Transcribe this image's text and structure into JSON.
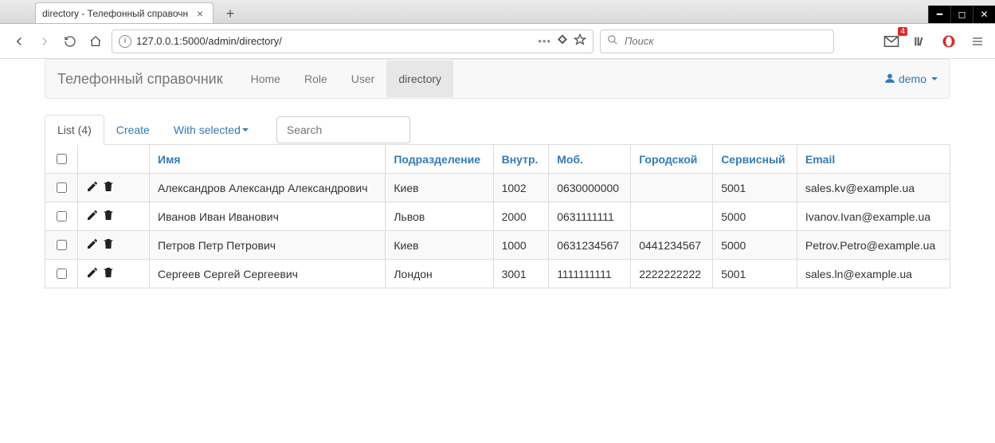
{
  "browser": {
    "tab_title": "directory - Телефонный справочн",
    "url": "127.0.0.1:5000/admin/directory/",
    "search_placeholder": "Поиск",
    "mail_badge": "4"
  },
  "navbar": {
    "brand": "Телефонный справочник",
    "links": [
      "Home",
      "Role",
      "User",
      "directory"
    ],
    "active_index": 3,
    "user": "demo"
  },
  "actions": {
    "list_label": "List (4)",
    "create_label": "Create",
    "with_selected_label": "With selected",
    "search_placeholder": "Search"
  },
  "table": {
    "columns": [
      "Имя",
      "Подразделение",
      "Внутр.",
      "Моб.",
      "Городской",
      "Сервисный",
      "Email"
    ],
    "rows": [
      {
        "name": "Александров Александр Александрович",
        "dept": "Киев",
        "ext": "1002",
        "mobile": "0630000000",
        "city": "",
        "service": "5001",
        "email": "sales.kv@example.ua"
      },
      {
        "name": "Иванов Иван Иванович",
        "dept": "Львов",
        "ext": "2000",
        "mobile": "0631111111",
        "city": "",
        "service": "5000",
        "email": "Ivanov.Ivan@example.ua"
      },
      {
        "name": "Петров Петр Петрович",
        "dept": "Киев",
        "ext": "1000",
        "mobile": "0631234567",
        "city": "0441234567",
        "service": "5000",
        "email": "Petrov.Petro@example.ua"
      },
      {
        "name": "Сергеев Сергей Сергеевич",
        "dept": "Лондон",
        "ext": "3001",
        "mobile": "1111111111",
        "city": "2222222222",
        "service": "5001",
        "email": "sales.ln@example.ua"
      }
    ]
  }
}
